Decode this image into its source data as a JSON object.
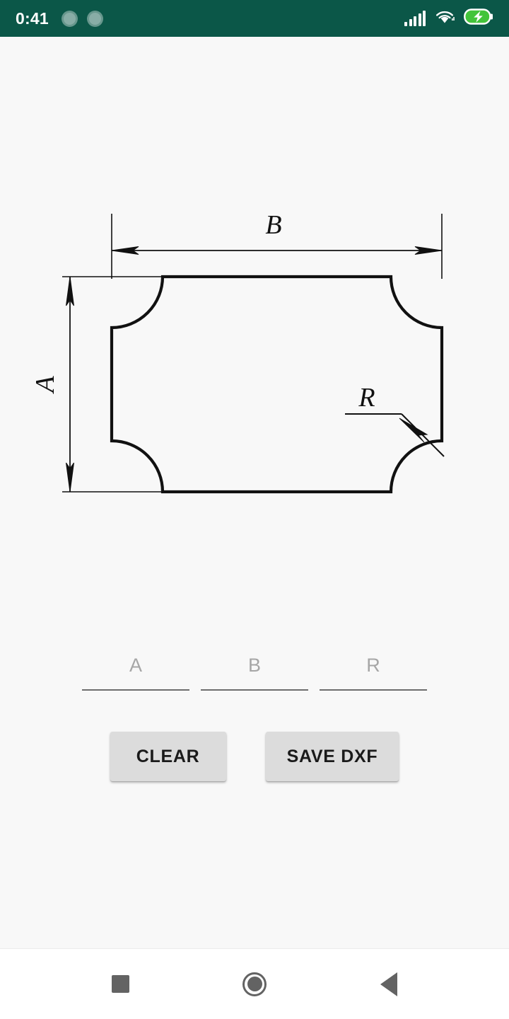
{
  "status_bar": {
    "time": "0:41",
    "background_color": "#0b5748",
    "notification_icons": [
      "notification-circle-1",
      "notification-circle-2"
    ],
    "right_icons": [
      "signal-bars-icon",
      "wifi-icon",
      "battery-charging-icon"
    ],
    "battery_color": "#43c43a"
  },
  "drawing": {
    "title_label_b": "B",
    "title_label_a": "A",
    "radius_label_r": "R",
    "stroke_color": "#000000",
    "background_color": "#f8f8f8",
    "description": "Rectangle with concave radius cutouts at all four corners, dimensioned A (height), B (width), R (corner radius)"
  },
  "inputs": [
    {
      "name": "field-a",
      "placeholder": "A",
      "value": ""
    },
    {
      "name": "field-b",
      "placeholder": "B",
      "value": ""
    },
    {
      "name": "field-r",
      "placeholder": "R",
      "value": ""
    }
  ],
  "buttons": {
    "clear_label": "CLEAR",
    "save_label": "SAVE DXF",
    "background_color": "#dcdcdc"
  },
  "nav_bar": {
    "items": [
      "recents-square-icon",
      "home-circle-icon",
      "back-triangle-icon"
    ],
    "icon_color": "#636363"
  }
}
